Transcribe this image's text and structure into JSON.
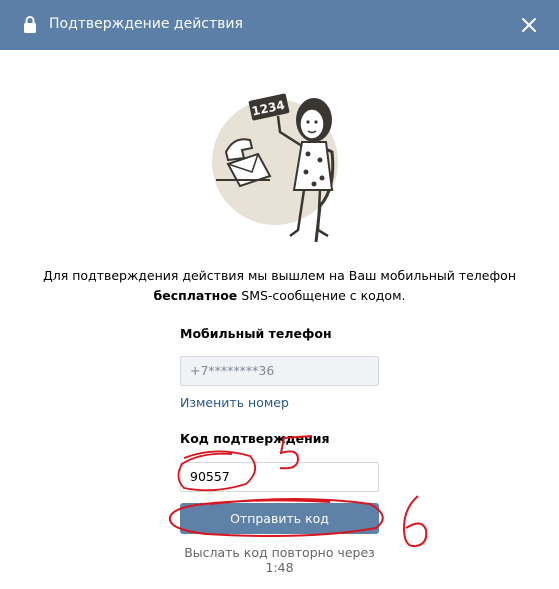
{
  "dialog": {
    "title": "Подтверждение действия"
  },
  "icons": {
    "lock": "lock-icon",
    "close": "close-icon"
  },
  "illustration": {
    "sign_text": "1234"
  },
  "info": {
    "line1": "Для подтверждения действия мы вышлем на Ваш мобильный телефон",
    "bold": "бесплатное",
    "rest": " SMS-сообщение с кодом."
  },
  "phone": {
    "label": "Мобильный телефон",
    "value": "+7********36",
    "change_link": "Изменить номер"
  },
  "code": {
    "label": "Код подтверждения",
    "value": "90557"
  },
  "submit_label": "Отправить код",
  "resend_text": "Выслать код повторно через 1:48",
  "annotations": {
    "mark5": "5",
    "mark6": "6",
    "color": "#d9161d"
  },
  "colors": {
    "header": "#5b7fa6",
    "button": "#5e81a8",
    "link": "#2a5885"
  }
}
